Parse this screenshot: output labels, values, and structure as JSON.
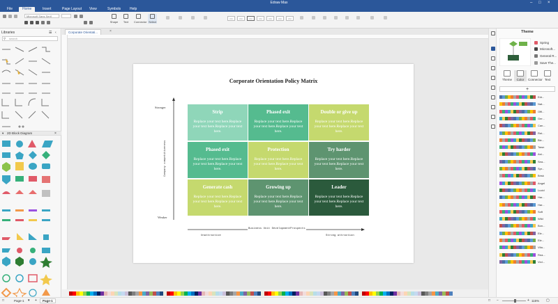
{
  "window": {
    "title": "Edraw Max"
  },
  "menu": [
    "File",
    "Home",
    "Insert",
    "Page Layout",
    "View",
    "Symbols",
    "Help"
  ],
  "ribbon": {
    "font_name": "Microsoft Sans Serif",
    "buttons": [
      "Shape",
      "Text",
      "Connector",
      "Select"
    ],
    "style_boxes": [
      "Abc",
      "Abc",
      "Abc",
      "Abc",
      "Abc",
      "Abc",
      "Abc"
    ]
  },
  "libraries": {
    "title": "Libraries",
    "search_placeholder": "search",
    "section": "2D Block Diagram"
  },
  "tab": {
    "label": "Corporate Orientati..."
  },
  "diagram": {
    "title": "Corporate Orientation Policy Matrix",
    "y_axis_top": "Stronger",
    "y_axis_bottom": "Weaker",
    "y_axis_label": "Company competitiveness",
    "x_axis_label": "Business Unit DevelopmentProspects",
    "x_left": "Unattractive",
    "x_right": "Strong attraction",
    "cells": [
      {
        "title": "Strip",
        "body": "Replace your text here.Replace your text here.Replace your text here.",
        "color": "#8fd6b9"
      },
      {
        "title": "Phased exit",
        "body": "Replace your text here.Replace your text here.Replace your text here.",
        "color": "#55bb8f"
      },
      {
        "title": "Double or give up",
        "body": "Replace your text here.Replace your text here.Replace your text here.",
        "color": "#c5d96e"
      },
      {
        "title": "Phased exit",
        "body": "Replace your text here.Replace your text here.Replace your text here.",
        "color": "#55bb8f"
      },
      {
        "title": "Protection",
        "body": "Replace your text here.Replace your text here.Replace your text here.",
        "color": "#c5d96e"
      },
      {
        "title": "Try harder",
        "body": "Replace your text here.Replace your text here.Replace your text here.",
        "color": "#5e9470"
      },
      {
        "title": "Generate cash",
        "body": "Replace your text here.Replace your text here.Replace your text here.",
        "color": "#c5d96e"
      },
      {
        "title": "Growing up",
        "body": "Replace your text here.Replace your text here.Replace your text here.",
        "color": "#5e9470"
      },
      {
        "title": "Leader",
        "body": "Replace your text here.Replace your text here.Replace your text here.",
        "color": "#2b5a3c"
      }
    ]
  },
  "status": {
    "page_selector": "Page-1",
    "page_tab": "Page-1",
    "zoom": "115%"
  },
  "right_panel": {
    "title": "Theme",
    "theme_options": [
      "Spring",
      "Microsoft...",
      "General R...",
      "Save The..."
    ],
    "tabs": [
      "Theme",
      "Color",
      "Connector",
      "Text"
    ],
    "palette_names": [
      "Edr...",
      "Nat...",
      "Offi...",
      "Ger...",
      "Can...",
      "Ret...",
      "Ble...",
      "Tawn",
      "Ast...",
      "Sea...",
      "Spr...",
      "Brisk",
      "Angel",
      "Lucid",
      "Har...",
      "Har...",
      "Soft",
      "Wild",
      "Bon...",
      "Ele...",
      "Ele...",
      "Vita...",
      "Rea...",
      "Viol..."
    ]
  }
}
